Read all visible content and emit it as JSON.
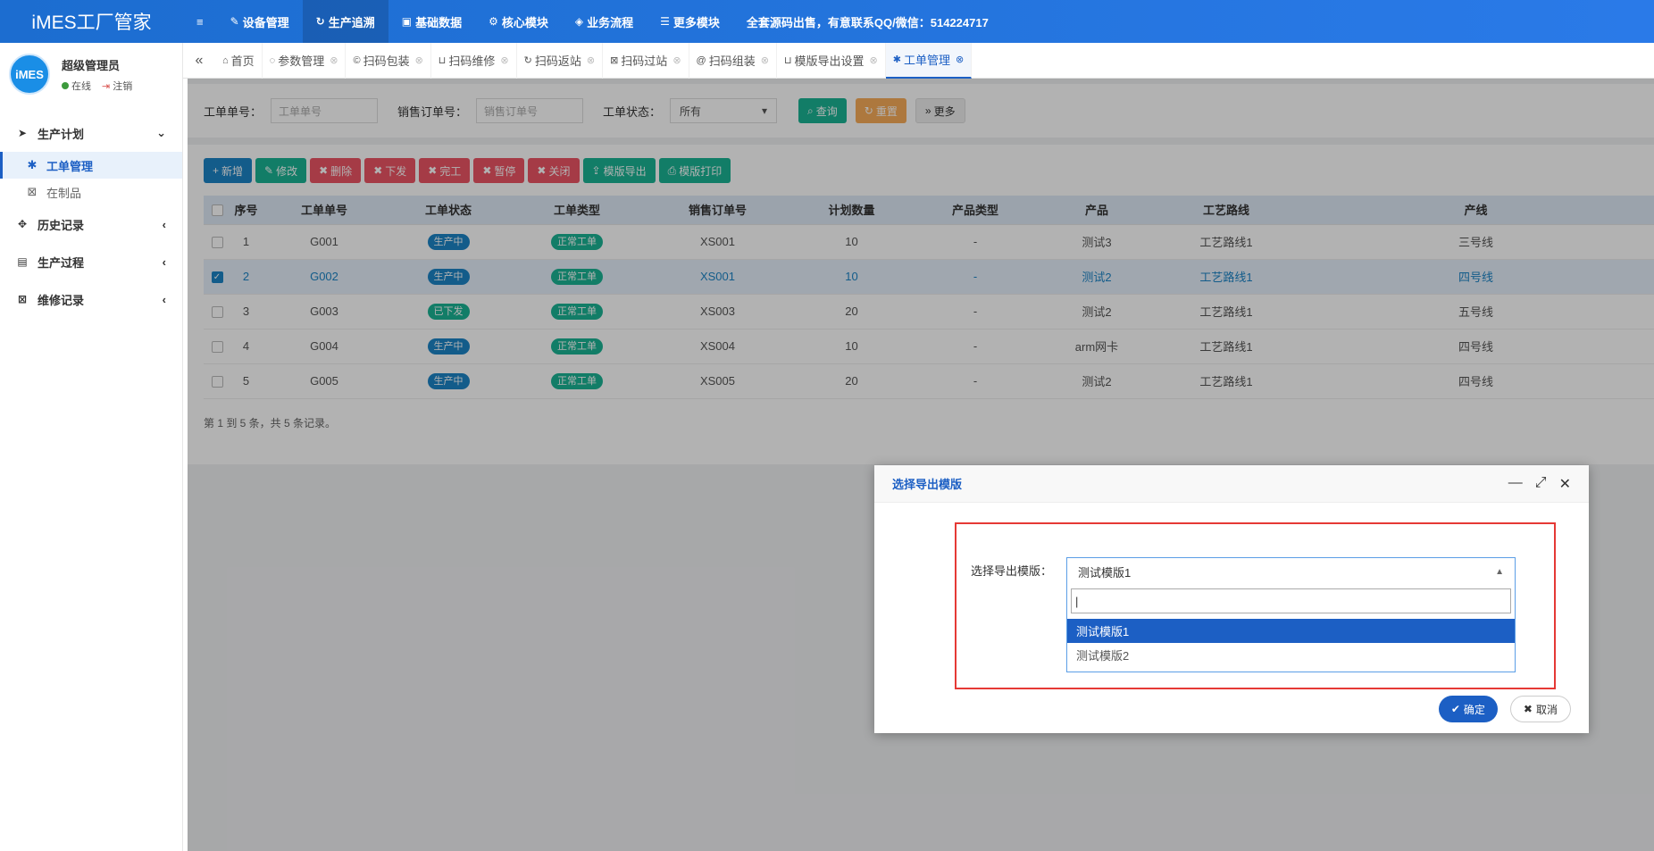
{
  "app": {
    "title": "iMES工厂管家"
  },
  "topnav": {
    "items": [
      {
        "label": "设备管理",
        "icon": "pin-icon"
      },
      {
        "label": "生产追溯",
        "icon": "refresh-icon"
      },
      {
        "label": "基础数据",
        "icon": "user-card-icon"
      },
      {
        "label": "核心模块",
        "icon": "gear-icon"
      },
      {
        "label": "业务流程",
        "icon": "flow-icon"
      },
      {
        "label": "更多模块",
        "icon": "list-icon"
      }
    ],
    "notice": "全套源码出售，有意联系QQ/微信：514224717"
  },
  "user": {
    "name": "超级管理员",
    "status": "在线",
    "logout": "注销",
    "avatar_text": "iMES"
  },
  "sidebar": {
    "groups": [
      {
        "label": "生产计划",
        "icon": "send-icon"
      },
      {
        "label": "历史记录",
        "icon": "move-icon"
      },
      {
        "label": "生产过程",
        "icon": "id-card-icon"
      },
      {
        "label": "维修记录",
        "icon": "close-box-icon"
      }
    ],
    "sub": [
      {
        "label": "工单管理",
        "icon": "asterisk-icon"
      },
      {
        "label": "在制品",
        "icon": "box-x-icon"
      }
    ]
  },
  "tabs": [
    {
      "label": "首页",
      "icon": "home-icon"
    },
    {
      "label": "参数管理",
      "icon": "spinner-icon"
    },
    {
      "label": "扫码包装",
      "icon": "copyright-icon"
    },
    {
      "label": "扫码维修",
      "icon": "bath-icon"
    },
    {
      "label": "扫码返站",
      "icon": "refresh-icon"
    },
    {
      "label": "扫码过站",
      "icon": "close-box-icon"
    },
    {
      "label": "扫码组装",
      "icon": "at-icon"
    },
    {
      "label": "模版导出设置",
      "icon": "bath-icon"
    },
    {
      "label": "工单管理",
      "icon": "asterisk-icon"
    }
  ],
  "search": {
    "order_no_label": "工单单号：",
    "order_no_placeholder": "工单单号",
    "sales_no_label": "销售订单号：",
    "sales_no_placeholder": "销售订单号",
    "status_label": "工单状态：",
    "status_value": "所有",
    "query": "查询",
    "reset": "重置",
    "more": "更多"
  },
  "toolbar": {
    "add": "新增",
    "edit": "修改",
    "delete": "删除",
    "issue": "下发",
    "finish": "完工",
    "pause": "暂停",
    "close": "关闭",
    "export": "模版导出",
    "print": "模版打印"
  },
  "table": {
    "headers": [
      "序号",
      "工单单号",
      "工单状态",
      "工单类型",
      "销售订单号",
      "计划数量",
      "产品类型",
      "产品",
      "工艺路线",
      "产线"
    ],
    "rows": [
      {
        "no": "1",
        "order": "G001",
        "status": "生产中",
        "type": "正常工单",
        "sales": "XS001",
        "qty": "10",
        "ptype": "-",
        "product": "测试3",
        "route": "工艺路线1",
        "line": "三号线"
      },
      {
        "no": "2",
        "order": "G002",
        "status": "生产中",
        "type": "正常工单",
        "sales": "XS001",
        "qty": "10",
        "ptype": "-",
        "product": "测试2",
        "route": "工艺路线1",
        "line": "四号线"
      },
      {
        "no": "3",
        "order": "G003",
        "status": "已下发",
        "type": "正常工单",
        "sales": "XS003",
        "qty": "20",
        "ptype": "-",
        "product": "测试2",
        "route": "工艺路线1",
        "line": "五号线"
      },
      {
        "no": "4",
        "order": "G004",
        "status": "生产中",
        "type": "正常工单",
        "sales": "XS004",
        "qty": "10",
        "ptype": "-",
        "product": "arm网卡",
        "route": "工艺路线1",
        "line": "四号线"
      },
      {
        "no": "5",
        "order": "G005",
        "status": "生产中",
        "type": "正常工单",
        "sales": "XS005",
        "qty": "20",
        "ptype": "-",
        "product": "测试2",
        "route": "工艺路线1",
        "line": "四号线"
      }
    ],
    "pager": "第 1 到 5 条，共 5 条记录。"
  },
  "dialog": {
    "title": "选择导出模版",
    "field_label": "选择导出模版：",
    "selected": "测试模版1",
    "search_value": "",
    "options": [
      "测试模版1",
      "测试模版2"
    ],
    "ok": "确定",
    "cancel": "取消"
  },
  "colors": {
    "brand": "#1c6dd0",
    "accent": "#1c5fc4",
    "highlight_border": "#e53935"
  }
}
